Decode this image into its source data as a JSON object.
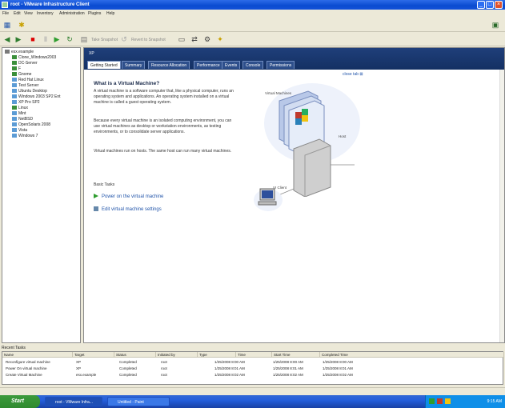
{
  "window": {
    "title": "root - VMware Infrastructure Client",
    "minimize": "_",
    "maximize": "□",
    "close": "×"
  },
  "menu": [
    "File",
    "Edit",
    "View",
    "Inventory",
    "Administration",
    "Plugins",
    "Help"
  ],
  "toolbar2": {
    "take_snapshot_label": "Take Snapshot",
    "revert_label": "Revert to Snapshot"
  },
  "tree": [
    {
      "label": "esx.example",
      "type": "host"
    },
    {
      "label": "Clone_Windows2003",
      "type": "vm"
    },
    {
      "label": "DC-Server",
      "type": "vm"
    },
    {
      "label": "F",
      "type": "vm"
    },
    {
      "label": "Gnome",
      "type": "vm"
    },
    {
      "label": "Red Hat Linux",
      "type": "vm-off"
    },
    {
      "label": "Test Server",
      "type": "vm-off"
    },
    {
      "label": "Ubuntu Desktop",
      "type": "vm-off"
    },
    {
      "label": "Windows 2003 SP2 Ent",
      "type": "vm-off"
    },
    {
      "label": "XP Pro SP2",
      "type": "vm-off"
    },
    {
      "label": "Linux",
      "type": "vm"
    },
    {
      "label": "Mint",
      "type": "vm-off"
    },
    {
      "label": "NetBSD",
      "type": "vm-off"
    },
    {
      "label": "OpenSolaris 2008",
      "type": "vm-off"
    },
    {
      "label": "Vista",
      "type": "vm-off"
    },
    {
      "label": "Windows 7",
      "type": "vm-off"
    }
  ],
  "main": {
    "vm_name": "XP",
    "tabs": [
      "Getting Started",
      "Summary",
      "Resource Allocation",
      "Performance",
      "Events",
      "Console",
      "Permissions"
    ],
    "close_tab": "close tab",
    "heading": "What is a Virtual Machine?",
    "para1": "A virtual machine is a software computer that, like a physical computer, runs an operating system and applications. An operating system installed on a virtual machine is called a guest operating system.",
    "para2": "Because every virtual machine is an isolated computing environment, you can use virtual machines as desktop or workstation environments, as testing environments, or to consolidate server applications.",
    "para3": "Virtual machines run on hosts. The same host can run many virtual machines.",
    "basic_tasks": "Basic Tasks",
    "task1": "Power on the virtual machine",
    "task2": "Edit virtual machine settings",
    "diagram": {
      "vms_label": "Virtual Machines",
      "host_label": "Host",
      "client_label": "VI Client"
    }
  },
  "recent_tasks": {
    "header": "Recent Tasks",
    "columns": [
      "Name",
      "Target",
      "Status",
      "Initiated by",
      "Type",
      "Time",
      "Start Time",
      "Completed Time"
    ],
    "rows": [
      {
        "name": "Reconfigure virtual machine",
        "target": "XP",
        "status": "Completed",
        "initiated": "root",
        "time": "1/25/2008 8:00 AM",
        "start": "1/25/2008 8:00 AM",
        "completed": "1/25/2008 8:00 AM"
      },
      {
        "name": "Power On virtual machine",
        "target": "XP",
        "status": "Completed",
        "initiated": "root",
        "time": "1/25/2008 8:01 AM",
        "start": "1/25/2008 8:01 AM",
        "completed": "1/25/2008 8:01 AM"
      },
      {
        "name": "Create Virtual Machine",
        "target": "esx.example",
        "status": "Completed",
        "initiated": "root",
        "time": "1/25/2008 8:02 AM",
        "start": "1/25/2008 8:02 AM",
        "completed": "1/25/2008 8:02 AM"
      }
    ]
  },
  "taskbar": {
    "start": "Start",
    "tasks": [
      "root - VMware Infra...",
      "Untitled - Paint"
    ],
    "clock": "9:15 AM"
  },
  "colors": {
    "header": "#1f3f7a",
    "link": "#2255aa",
    "title_bar": "#0a4bd0"
  }
}
